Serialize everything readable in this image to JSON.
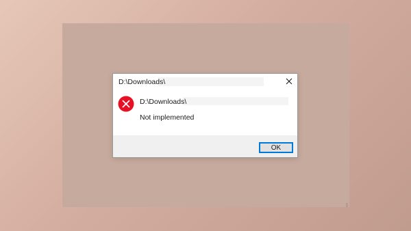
{
  "dialog": {
    "title": "D:\\Downloads\\",
    "path": "D:\\Downloads\\",
    "message": "Not implemented",
    "ok_label": "OK",
    "icon": "error-icon",
    "close_icon": "close-icon"
  },
  "colors": {
    "error_red": "#e81123",
    "accent_blue": "#0078d7",
    "footer_bg": "#f0f0f0"
  }
}
